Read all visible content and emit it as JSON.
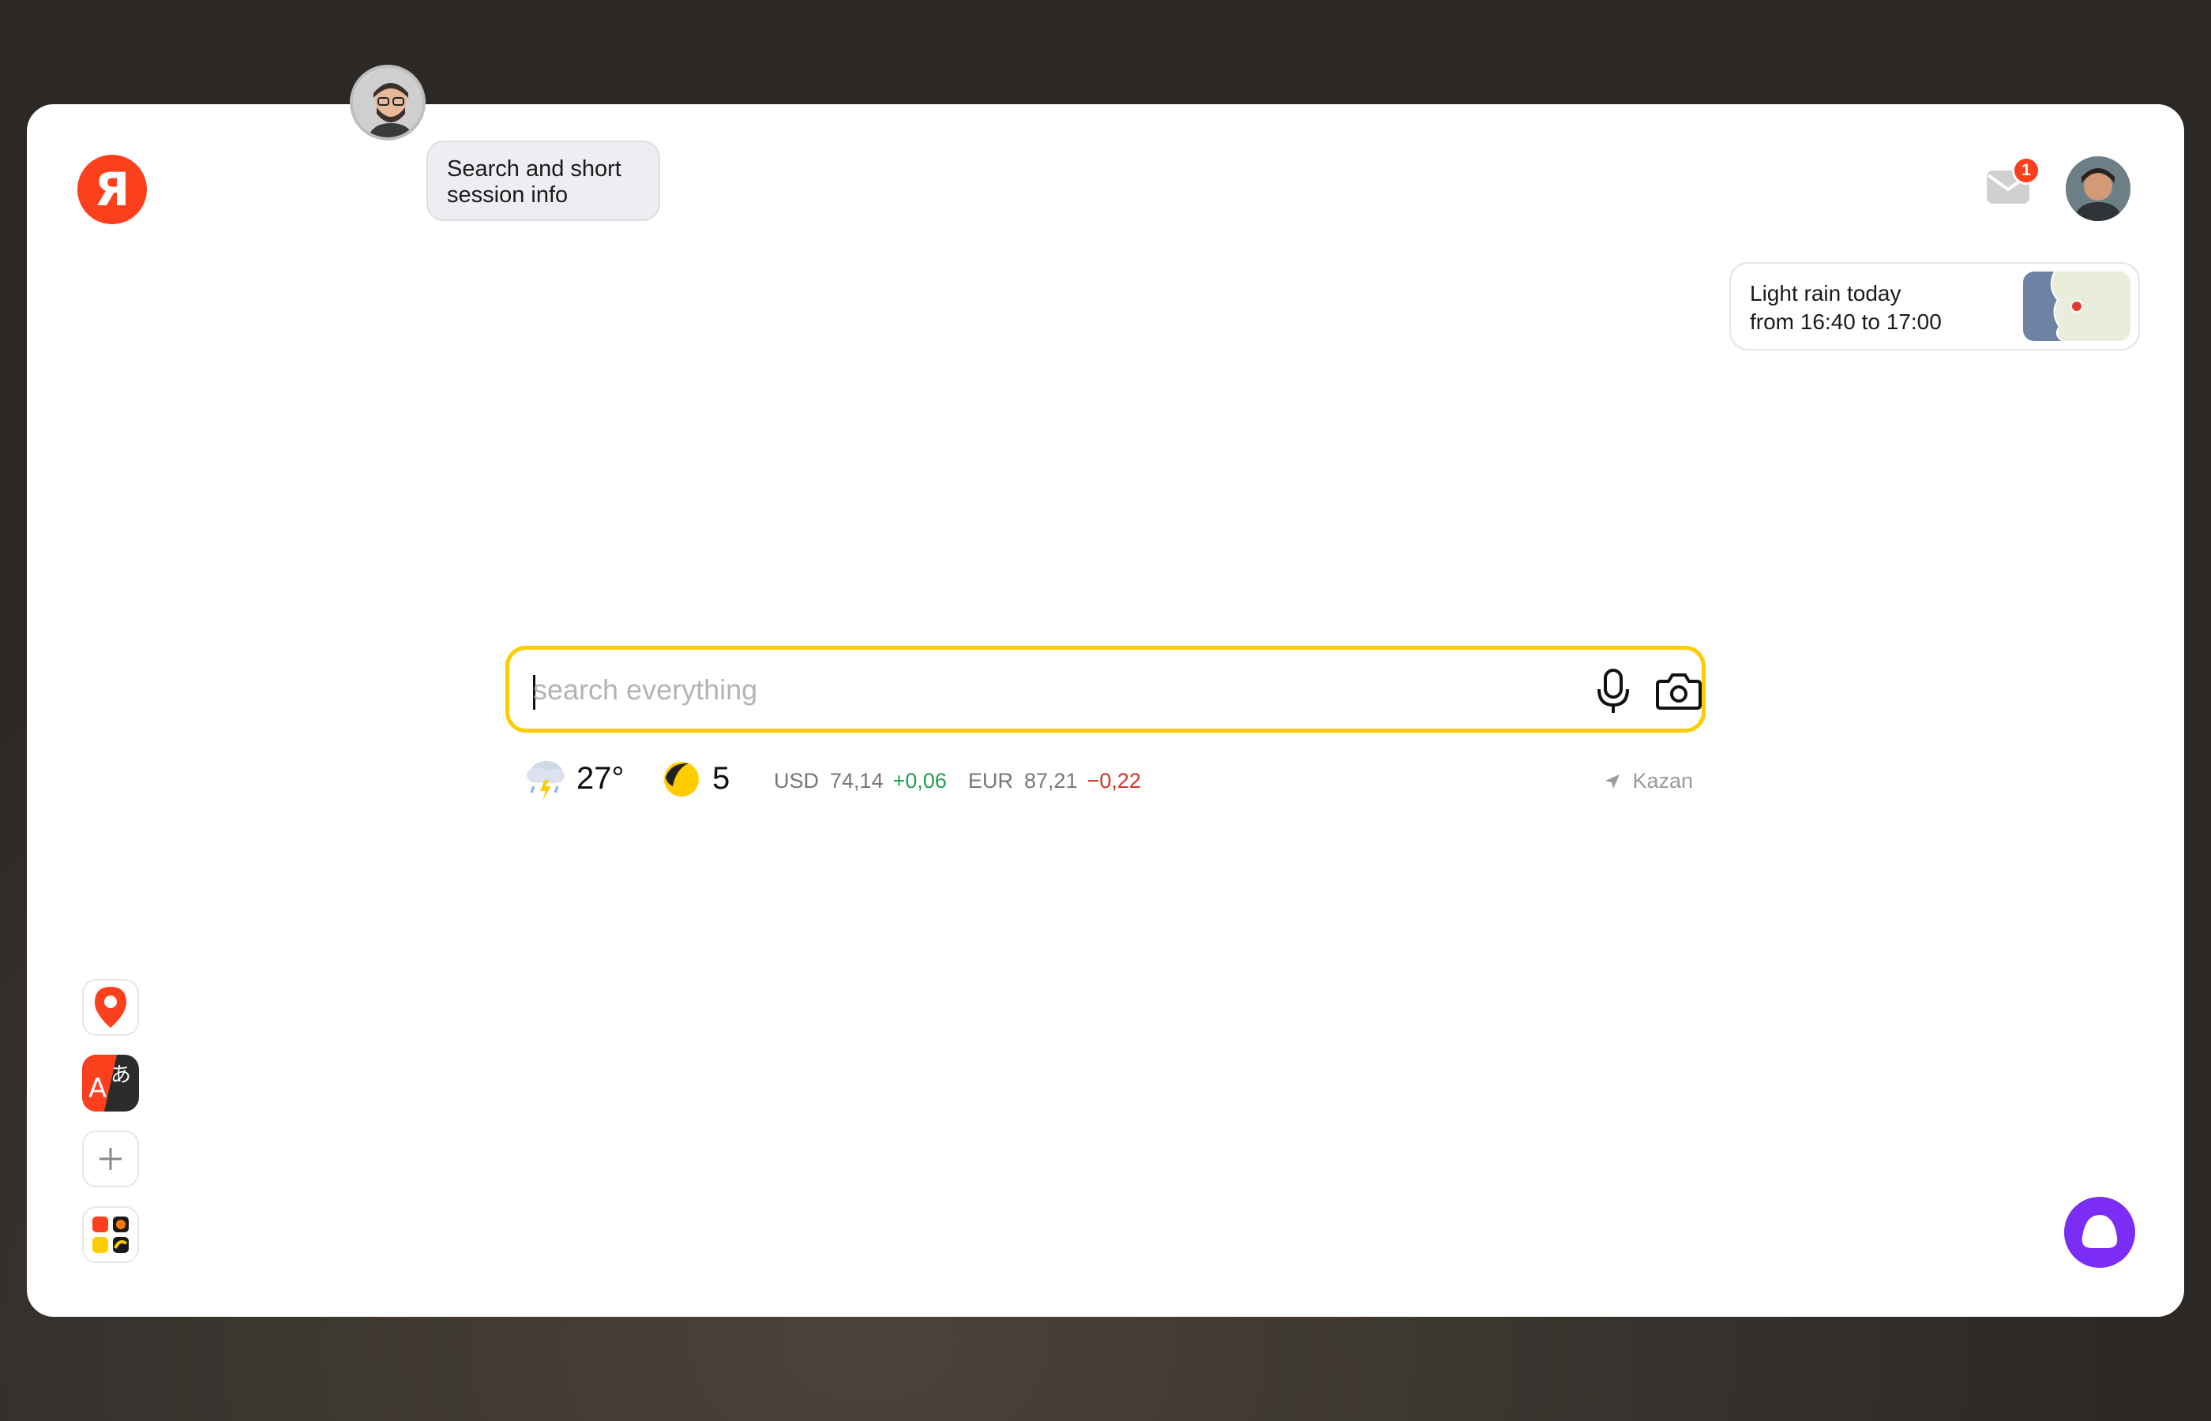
{
  "header": {
    "logo_letter": "Я",
    "logo_color": "#fc3f1d",
    "mail_icon": "mail-icon",
    "mail_badge_count": "1"
  },
  "annotation": {
    "line1": "Search and short",
    "line2": "session info"
  },
  "rain_card": {
    "line1": "Light rain today",
    "line2": "from 16:40 to 17:00"
  },
  "search": {
    "placeholder": "search everything",
    "value": "",
    "accent_color": "#ffcc00",
    "icons": [
      "microphone-icon",
      "camera-icon"
    ]
  },
  "info": {
    "weather_icon": "thunderstorm-icon",
    "temperature": "27°",
    "traffic_icon": "traffic-icon",
    "traffic_level": "5",
    "rates": [
      {
        "currency": "USD",
        "value": "74,14",
        "change": "+0,06",
        "direction": "up"
      },
      {
        "currency": "EUR",
        "value": "87,21",
        "change": "−0,22",
        "direction": "down"
      }
    ],
    "location": "Kazan",
    "location_icon": "location-arrow-icon"
  },
  "apps": [
    "maps-app-icon",
    "translate-app-icon",
    "add-app-icon",
    "services-grid-icon"
  ],
  "assistant": {
    "icon": "alice-icon",
    "color": "#7b2cf5"
  }
}
